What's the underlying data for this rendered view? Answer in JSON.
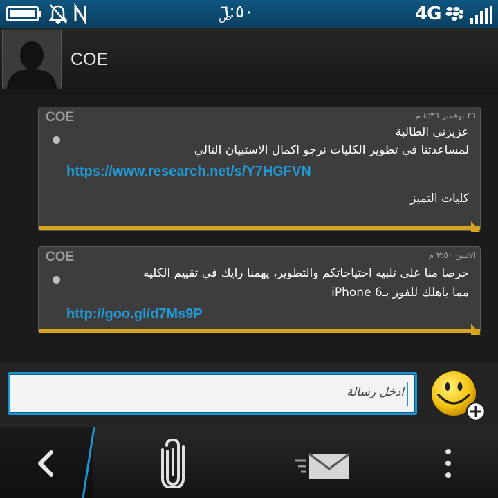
{
  "status_bar": {
    "time": "٦:٥٠",
    "ampm": "ص",
    "network": "4G",
    "icons": [
      "battery-icon",
      "mute-icon",
      "nfc-icon",
      "blackberry-icon",
      "signal-icon"
    ]
  },
  "header": {
    "contact_name": "COE",
    "avatar_icon": "default-avatar-icon"
  },
  "messages": [
    {
      "sender": "COE",
      "timestamp": "٢٦ نوفمبر ٤:٣٦ م",
      "lines": [
        "عزيزتي الطالبة",
        "لمساعدتنا في تطوير الكليات نرجو اكمال الاستبيان التالي"
      ],
      "link": "https://www.research.net/s/Y7HGFVN",
      "signature": "كليات التميز"
    },
    {
      "sender": "COE",
      "timestamp": "الاثنين ٣:٥٠ م",
      "lines": [
        "حرصا منا على تلبيه احتياجاتكم والتطوير، يهمنا رايك في تقييم الكليه",
        "مما ياهلك للفوز بـ6 iPhone"
      ],
      "link": "http://goo.gl/d7Ms9P"
    }
  ],
  "compose": {
    "placeholder": "ادخل رسالة",
    "emoji_icon": "emoji-add-icon"
  },
  "action_bar": {
    "icons": [
      "back-icon",
      "attach-icon",
      "send-icon",
      "more-icon"
    ]
  },
  "colors": {
    "accent": "#1d95d1",
    "bubble_bar": "#d8a320",
    "link": "#1f9ad6",
    "status_bar": "#0f5680"
  }
}
